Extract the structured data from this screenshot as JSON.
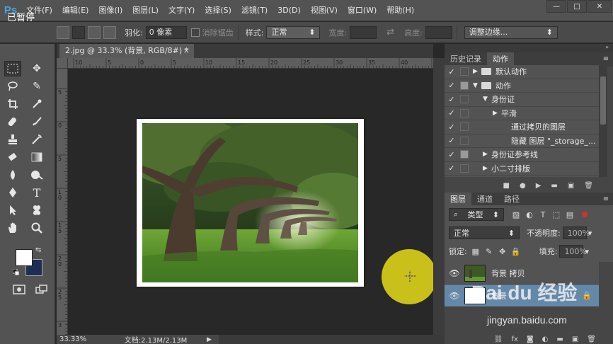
{
  "app": {
    "logo": "Ps"
  },
  "menu": [
    "文件(F)",
    "编辑(E)",
    "图像(I)",
    "图层(L)",
    "文字(Y)",
    "选择(S)",
    "滤镜(T)",
    "3D(D)",
    "视图(V)",
    "窗口(W)",
    "帮助(H)"
  ],
  "window_controls": {
    "minimize": "—",
    "maximize": "□",
    "close": "✕"
  },
  "overlay": {
    "paused": "已暂停"
  },
  "options": {
    "feather_label": "羽化:",
    "feather_value": "0 像素",
    "antialias": "消除锯齿",
    "style_label": "样式:",
    "style_value": "正常",
    "width_label": "宽度:",
    "height_label": "高度:",
    "refine_edge": "调整边缘..."
  },
  "document": {
    "tab_title": "2.jpg @ 33.3% (背景, RGB/8#) *",
    "tab_close": "×",
    "ruler_h": [
      "10",
      "5",
      "0",
      "5",
      "10",
      "15",
      "20",
      "25",
      "30",
      "35",
      "40",
      "4"
    ],
    "ruler_v": [
      "5",
      "0",
      "5",
      "1 0",
      "1 5",
      "2 0",
      "2 5",
      "3"
    ]
  },
  "status": {
    "zoom": "33.33%",
    "doc_info": "文档:2.13M/2.13M",
    "arrow": "▶"
  },
  "actions_panel": {
    "tabs": [
      "历史记录",
      "动作"
    ],
    "active_tab": "动作",
    "rows": [
      {
        "label": "默认动作",
        "indent": 0,
        "expanded": false,
        "folder": true,
        "box_filled": false
      },
      {
        "label": "动作",
        "indent": 0,
        "expanded": true,
        "folder": true,
        "box_filled": true
      },
      {
        "label": "身份证",
        "indent": 1,
        "expanded": true,
        "folder": false,
        "box_filled": false
      },
      {
        "label": "平滑",
        "indent": 2,
        "expanded": false,
        "folder": false,
        "box_filled": false
      },
      {
        "label": "通过拷贝的图层",
        "indent": 3,
        "expanded": null,
        "folder": false,
        "box_filled": false
      },
      {
        "label": "隐藏 图层 \"_storage_...",
        "indent": 3,
        "expanded": null,
        "folder": false,
        "box_filled": false
      },
      {
        "label": "身份证参考线",
        "indent": 1,
        "expanded": false,
        "folder": false,
        "box_filled": true
      },
      {
        "label": "小二寸排版",
        "indent": 1,
        "expanded": false,
        "folder": false,
        "box_filled": false
      }
    ]
  },
  "layers_panel": {
    "tabs": [
      "图层",
      "通道",
      "路径"
    ],
    "active_tab": "图层",
    "filter": "类型",
    "blend_mode": "正常",
    "opacity_label": "不透明度:",
    "opacity_value": "100%",
    "lock_label": "锁定:",
    "fill_label": "填充:",
    "fill_value": "100%",
    "layers": [
      {
        "name": "背景 拷贝",
        "selected": false
      },
      {
        "name": "背景",
        "selected": true
      }
    ]
  },
  "watermark": {
    "brand": "Bai du 经验",
    "url": "jingyan.baidu.com"
  },
  "colors": {
    "foreground": "#ffffff",
    "background": "#1d2e52",
    "highlight": "#c9c01a",
    "selection": "#6688a8"
  }
}
